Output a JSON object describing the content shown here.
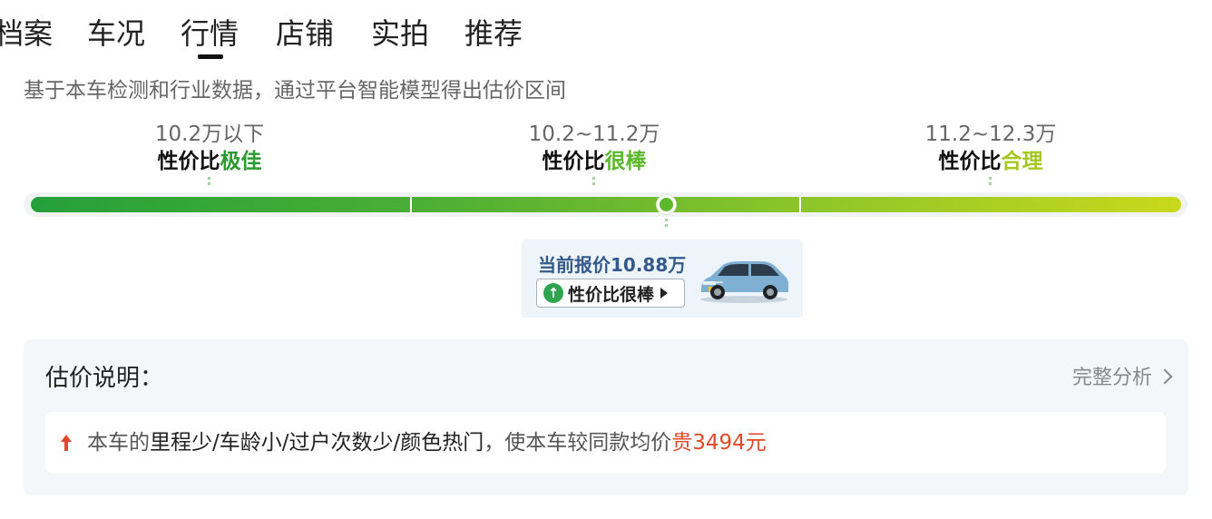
{
  "tabs": [
    {
      "label": "档案"
    },
    {
      "label": "车况"
    },
    {
      "label": "行情",
      "active": true
    },
    {
      "label": "店铺"
    },
    {
      "label": "实拍"
    },
    {
      "label": "推荐"
    }
  ],
  "subtitle": "基于本车检测和行业数据，通过平台智能模型得出估价区间",
  "ranges": [
    {
      "price": "10.2万以下",
      "rating_prefix": "性价比",
      "rating_word": "极佳",
      "word_color": "#2a9a2f"
    },
    {
      "price": "10.2~11.2万",
      "rating_prefix": "性价比",
      "rating_word": "很棒",
      "word_color": "#5cb82b"
    },
    {
      "price": "11.2~12.3万",
      "rating_prefix": "性价比",
      "rating_word": "合理",
      "word_color": "#a5c81f"
    }
  ],
  "bar": {
    "colors": [
      "#25a03a",
      "#6ab830",
      "#c9d81c"
    ],
    "marker_position": 0.552
  },
  "popup": {
    "price_label": "当前报价10.88万",
    "badge_label": "性价比很棒",
    "badge_icon": "up-arrow-circle-icon",
    "image": "car-thumbnail"
  },
  "explanation": {
    "title": "估价说明：",
    "full_analysis_label": "完整分析",
    "icon": "red-up-arrow-icon",
    "text_1": "本车的",
    "text_2": "里程少/车龄小/过户次数少/颜色热门",
    "text_3": "，使本车较同款均价",
    "text_4": "贵3494元",
    "highlight_color": "#e04a2a"
  }
}
